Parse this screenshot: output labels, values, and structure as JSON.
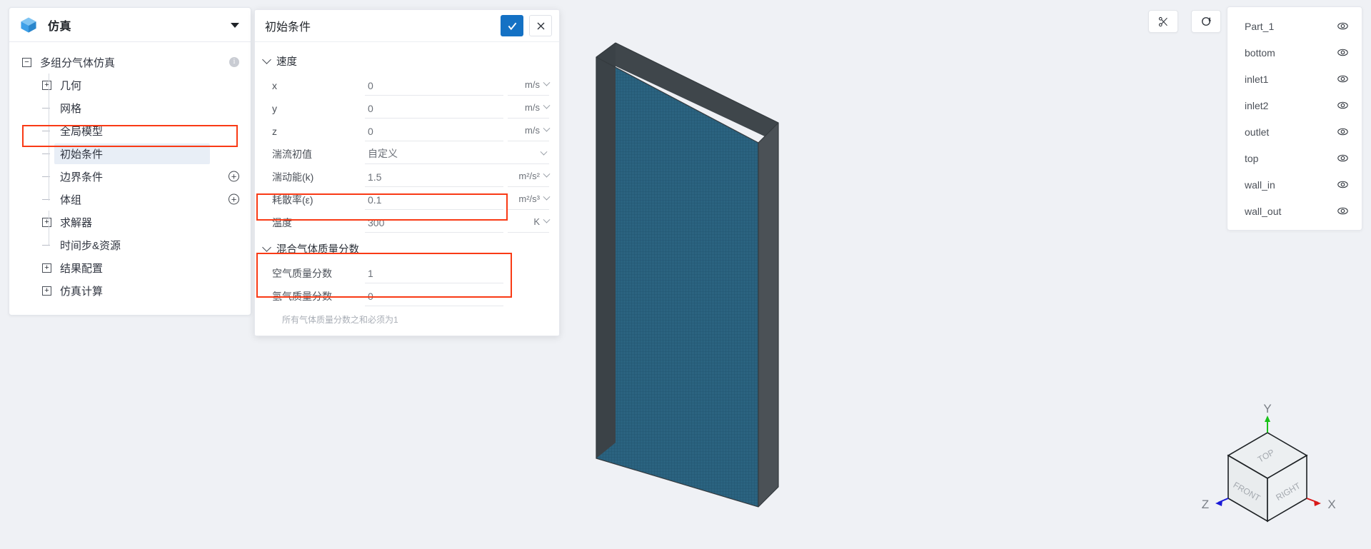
{
  "app": {
    "header": {
      "title": "仿真",
      "icon": "cube-icon",
      "dropdown_icon": "caret-down-icon"
    }
  },
  "sidebar": {
    "tree": [
      {
        "label": "多组分气体仿真",
        "level": 1,
        "toggle": "minus",
        "badge": "info"
      },
      {
        "label": "几何",
        "level": 2,
        "toggle": "plus"
      },
      {
        "label": "网格",
        "level": 3,
        "toggle": "dash"
      },
      {
        "label": "全局模型",
        "level": 3,
        "toggle": "dash"
      },
      {
        "label": "初始条件",
        "level": 3,
        "toggle": "dash",
        "selected": true,
        "highlighted": true
      },
      {
        "label": "边界条件",
        "level": 3,
        "toggle": "dash",
        "badge": "plus"
      },
      {
        "label": "体组",
        "level": 3,
        "toggle": "dash",
        "badge": "plus"
      },
      {
        "label": "求解器",
        "level": 2,
        "toggle": "plus"
      },
      {
        "label": "时间步&资源",
        "level": 3,
        "toggle": "dash"
      },
      {
        "label": "结果配置",
        "level": 2,
        "toggle": "plus"
      },
      {
        "label": "仿真计算",
        "level": 2,
        "toggle": "plus"
      }
    ]
  },
  "dialog": {
    "title": "初始条件",
    "confirm_label": "✓",
    "cancel_label": "✕",
    "sections": [
      {
        "name": "速度",
        "rows": [
          {
            "label": "x",
            "value": "0",
            "unit": "m/s",
            "has_unit_dropdown": true
          },
          {
            "label": "y",
            "value": "0",
            "unit": "m/s",
            "has_unit_dropdown": true
          },
          {
            "label": "z",
            "value": "0",
            "unit": "m/s",
            "has_unit_dropdown": true
          }
        ]
      }
    ],
    "extra_rows": [
      {
        "label": "湍流初值",
        "value": "自定义",
        "unit": "",
        "is_select": true
      },
      {
        "label": "湍动能(k)",
        "value": "1.5",
        "unit": "m²/s²",
        "has_unit_dropdown": true
      },
      {
        "label": "耗散率(ε)",
        "value": "0.1",
        "unit": "m²/s³",
        "has_unit_dropdown": true
      },
      {
        "label": "温度",
        "value": "300",
        "unit": "K",
        "has_unit_dropdown": true,
        "highlighted": true
      }
    ],
    "mixture_section": {
      "name": "混合气体质量分数",
      "rows": [
        {
          "label": "空气质量分数",
          "value": "1"
        },
        {
          "label": "氢气质量分数",
          "value": "0"
        }
      ],
      "hint": "所有气体质量分数之和必须为1"
    }
  },
  "toolbar": {
    "clip_label": "clip-tool",
    "reset_label": "reset-view"
  },
  "parts": {
    "items": [
      {
        "name": "Part_1",
        "visible": true
      },
      {
        "name": "bottom",
        "visible": true
      },
      {
        "name": "inlet1",
        "visible": true
      },
      {
        "name": "inlet2",
        "visible": true
      },
      {
        "name": "outlet",
        "visible": true
      },
      {
        "name": "top",
        "visible": true
      },
      {
        "name": "wall_in",
        "visible": true
      },
      {
        "name": "wall_out",
        "visible": true
      }
    ]
  },
  "viewcube": {
    "faces": {
      "top": "TOP",
      "front": "FRONT",
      "right": "RIGHT"
    },
    "axes": {
      "x": "X",
      "y": "Y",
      "z": "Z"
    },
    "axis_colors": {
      "x": "#d81a1a",
      "y": "#19c219",
      "z": "#1a1ad8"
    }
  },
  "colors": {
    "accent": "#1471c4",
    "highlight_outline": "#f93a15",
    "model_face": "#2b6380",
    "model_side": "#4b5156",
    "canvas_bg": "#eff1f5"
  }
}
